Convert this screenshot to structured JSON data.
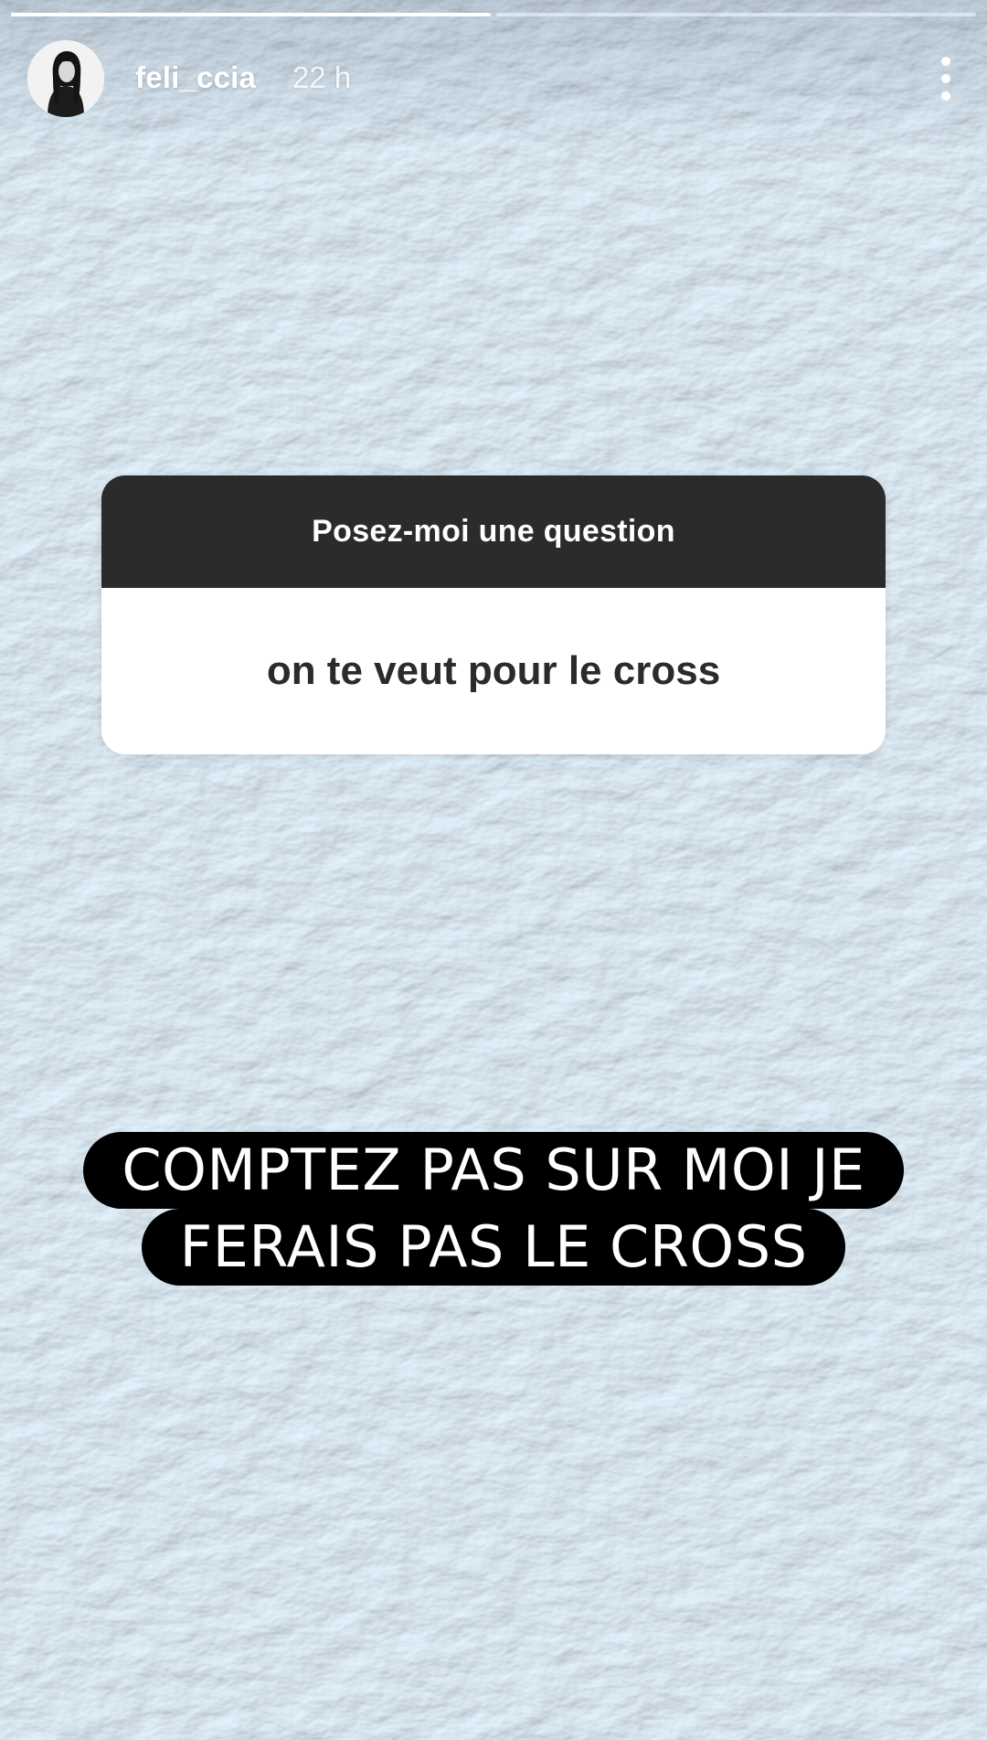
{
  "story": {
    "progress_segments": [
      {
        "state": "complete",
        "fill": 1.0
      },
      {
        "state": "current",
        "fill": 0.0
      }
    ],
    "header": {
      "username": "feli_ccia",
      "timestamp": "22 h",
      "avatar_icon": "profile-photo",
      "more_icon": "more-vertical-icon"
    },
    "question_sticker": {
      "title": "Posez-moi une question",
      "question": "on te veut pour le cross"
    },
    "caption": {
      "line1": "COMPTEZ PAS SUR MOI JE",
      "line2": "FERAIS PAS LE CROSS"
    },
    "colors": {
      "background": "#a9cfe9",
      "sticker_header": "#2b2b2b",
      "sticker_body": "#ffffff",
      "caption_bg": "#000000",
      "caption_text": "#ffffff"
    }
  }
}
